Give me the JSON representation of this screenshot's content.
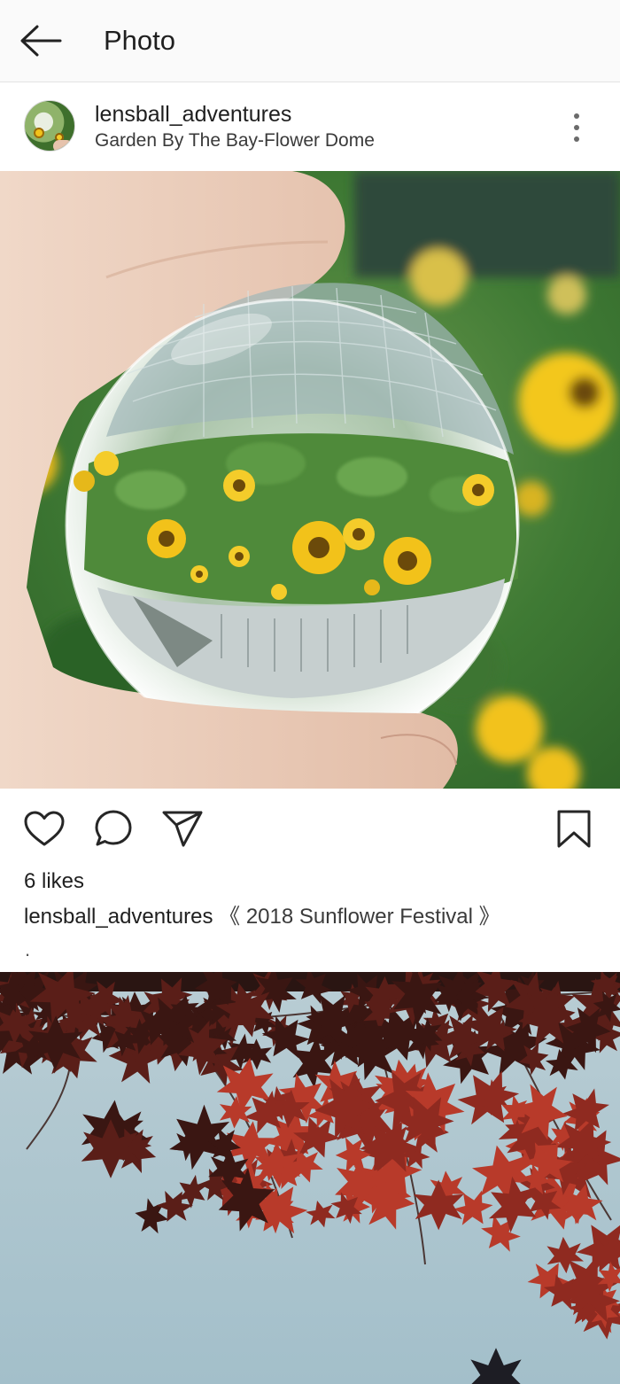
{
  "app_bar": {
    "title": "Photo",
    "back_icon": "arrow-left-icon"
  },
  "post": {
    "username": "lensball_adventures",
    "location": "Garden By The Bay-Flower Dome",
    "more_icon": "vertical-ellipsis-icon",
    "likes_text": "6 likes",
    "caption_user": "lensball_adventures",
    "caption_text": "《 2018 Sunflower Festival 》",
    "caption_extra": "."
  },
  "actions": {
    "like_icon": "heart-icon",
    "comment_icon": "comment-bubble-icon",
    "share_icon": "paper-plane-icon",
    "save_icon": "bookmark-icon"
  },
  "colors": {
    "app_bar_bg": "#fafafa",
    "text": "#262626",
    "sunflower": "#f2c21a",
    "foliage": "#4f8a3a",
    "maple_red": "#b83a2a",
    "sky": "#a9c3cd"
  }
}
